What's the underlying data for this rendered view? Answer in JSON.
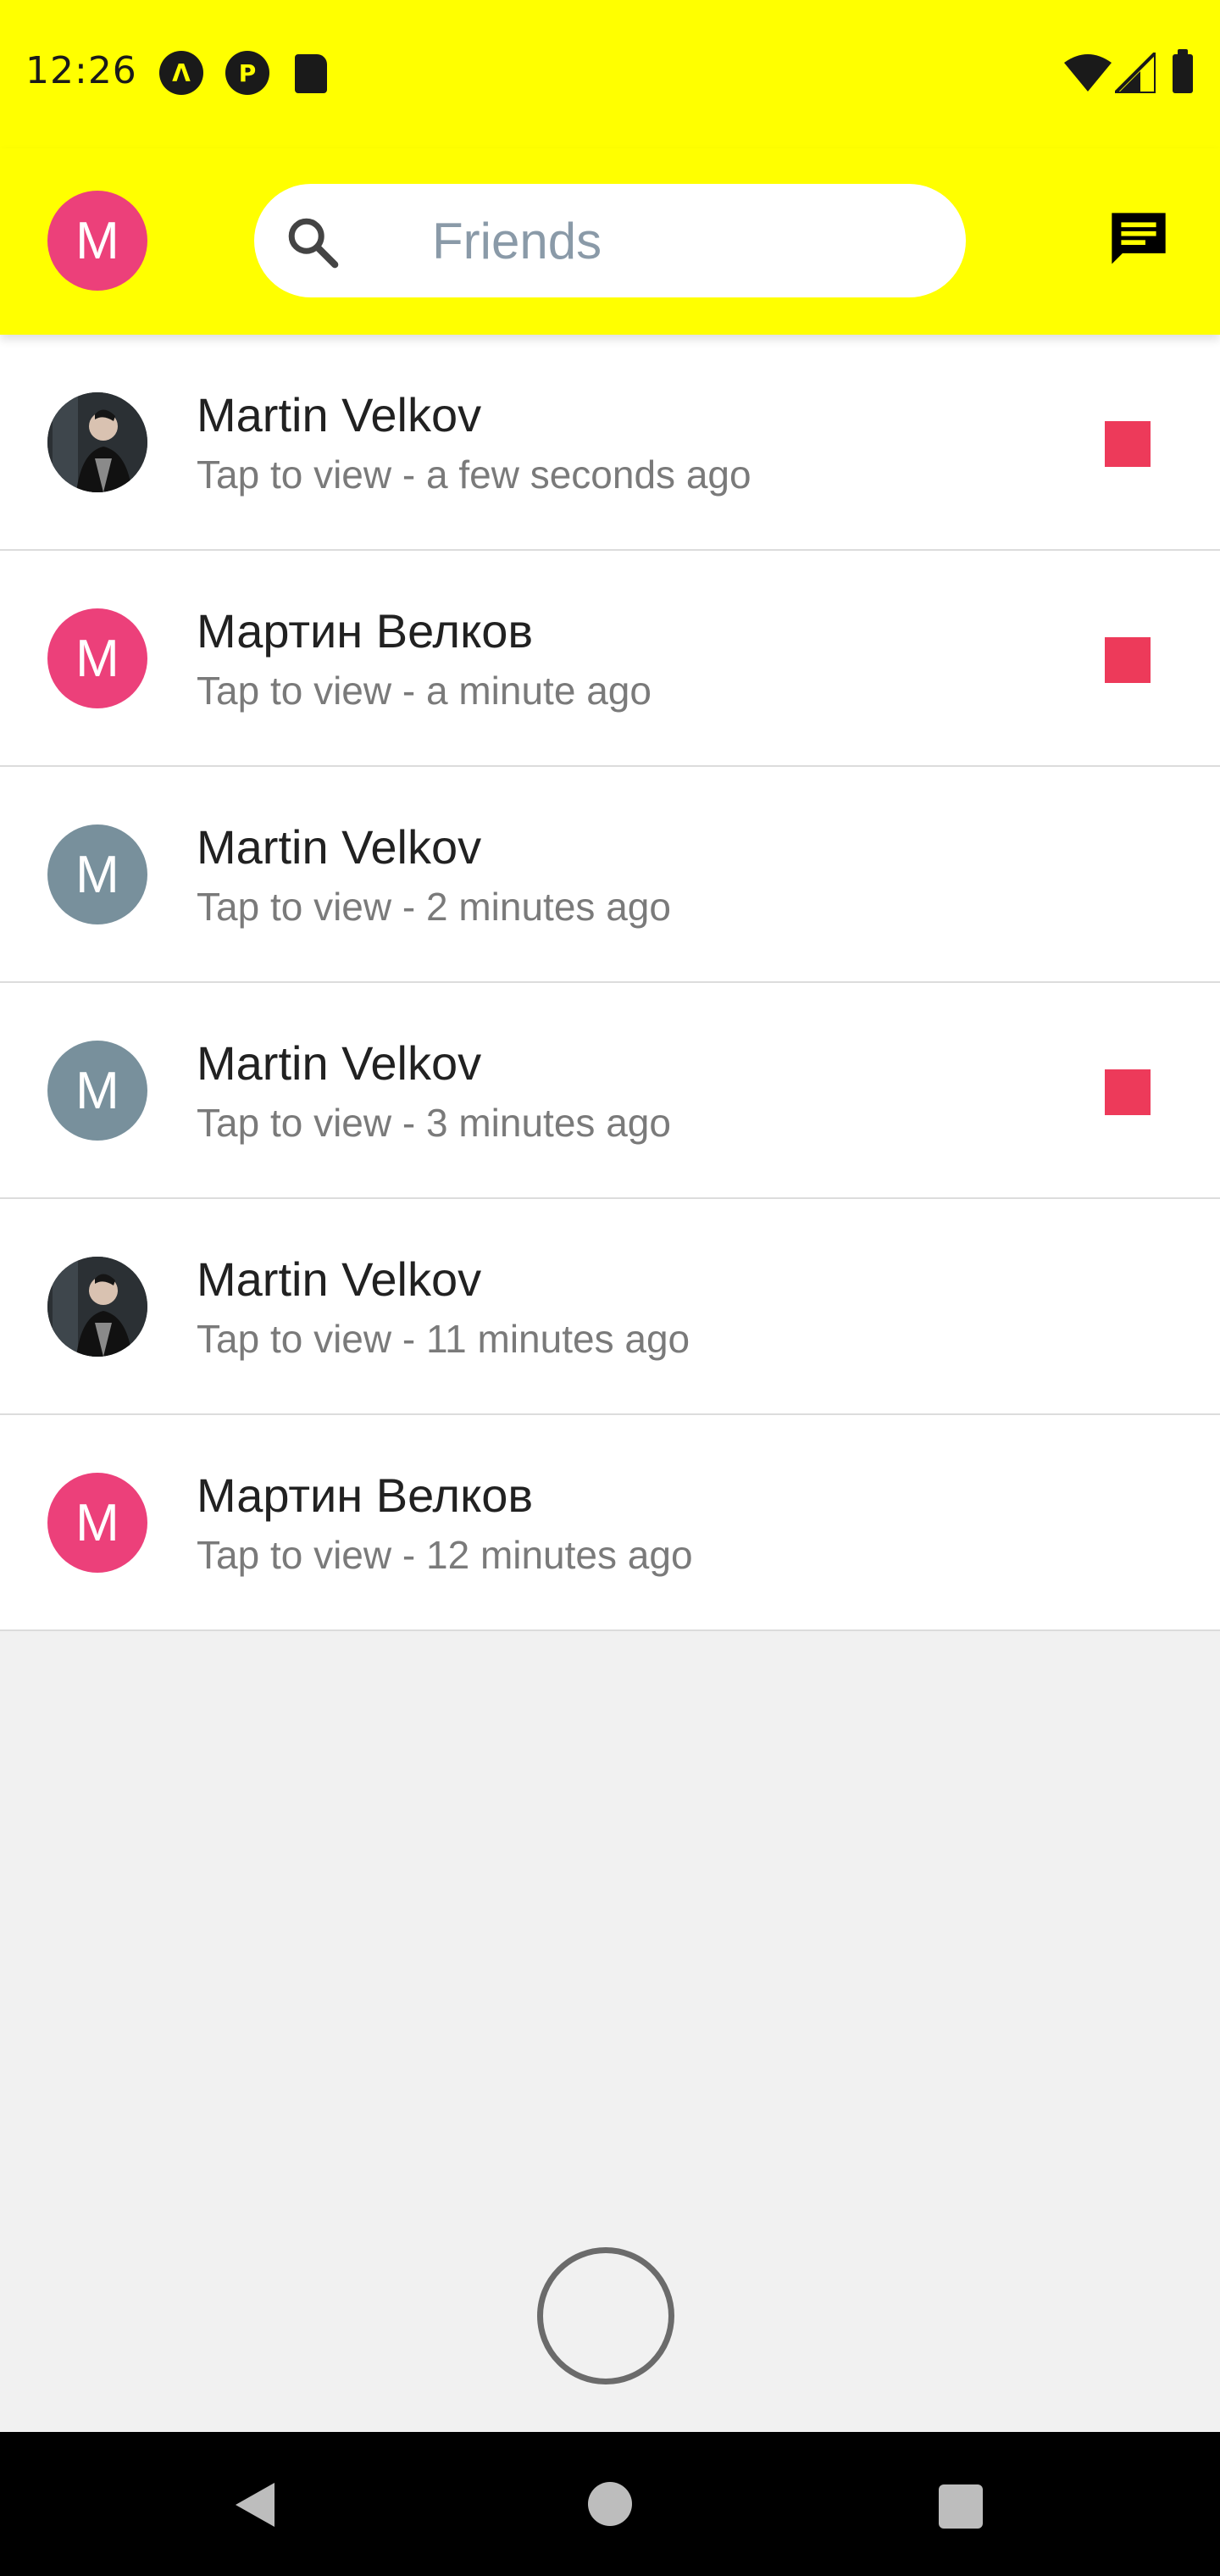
{
  "status_bar": {
    "time": "12:26",
    "icons": [
      "notification-a-icon",
      "notification-p-icon",
      "sd-card-icon",
      "wifi-icon",
      "signal-icon",
      "battery-icon"
    ]
  },
  "header": {
    "profile_initial": "M",
    "profile_color": "#ec407a",
    "search_placeholder": "Friends",
    "accent_color": "#ffff00"
  },
  "friends": [
    {
      "name": "Martin Velkov",
      "subtitle": "Tap to view - a few seconds ago",
      "avatar_type": "photo",
      "initial": "",
      "avatar_color": "#1f2326",
      "unread": true
    },
    {
      "name": "Мартин Велков",
      "subtitle": "Tap to view - a minute ago",
      "avatar_type": "initial",
      "initial": "M",
      "avatar_color": "#ec407a",
      "unread": true
    },
    {
      "name": "Martin Velkov",
      "subtitle": "Tap to view - 2 minutes ago",
      "avatar_type": "initial",
      "initial": "M",
      "avatar_color": "#78909c",
      "unread": false
    },
    {
      "name": "Martin Velkov",
      "subtitle": "Tap to view - 3 minutes ago",
      "avatar_type": "initial",
      "initial": "M",
      "avatar_color": "#78909c",
      "unread": true
    },
    {
      "name": "Martin Velkov",
      "subtitle": "Tap to view - 11 minutes ago",
      "avatar_type": "photo",
      "initial": "",
      "avatar_color": "#1f2326",
      "unread": false
    },
    {
      "name": "Мартин Велков",
      "subtitle": "Tap to view - 12 minutes ago",
      "avatar_type": "initial",
      "initial": "M",
      "avatar_color": "#ec407a",
      "unread": false
    }
  ],
  "unread_color": "#ed3a5a",
  "nav_bar": {
    "buttons": [
      "back-icon",
      "home-icon",
      "recents-icon"
    ]
  }
}
